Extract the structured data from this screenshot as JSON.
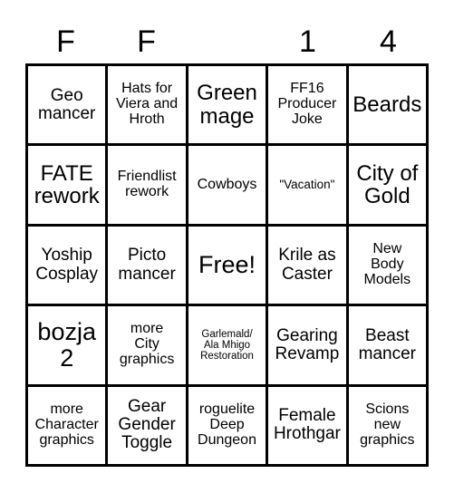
{
  "card": {
    "background_color": "#ffffff",
    "line_color": "#000000",
    "text_color": "#000000",
    "header": {
      "letters": [
        "F",
        "F",
        "",
        "1",
        "4"
      ]
    },
    "rows": [
      [
        {
          "text": "Geo\nmancer",
          "size": "l"
        },
        {
          "text": "Hats for\nViera and\nHroth",
          "size": "m"
        },
        {
          "text": "Green\nmage",
          "size": "xl"
        },
        {
          "text": "FF16\nProducer\nJoke",
          "size": "m"
        },
        {
          "text": "Beards",
          "size": "xl"
        }
      ],
      [
        {
          "text": "FATE\nrework",
          "size": "xl"
        },
        {
          "text": "Friendlist\nrework",
          "size": "m"
        },
        {
          "text": "Cowboys",
          "size": "m"
        },
        {
          "text": "\"Vacation\"",
          "size": "s"
        },
        {
          "text": "City of\nGold",
          "size": "xl"
        }
      ],
      [
        {
          "text": "Yoship\nCosplay",
          "size": "l"
        },
        {
          "text": "Picto\nmancer",
          "size": "l"
        },
        {
          "text": "Free!",
          "size": "xxl"
        },
        {
          "text": "Krile as\nCaster",
          "size": "l"
        },
        {
          "text": "New\nBody\nModels",
          "size": "m"
        }
      ],
      [
        {
          "text": "bozja\n2",
          "size": "xxl"
        },
        {
          "text": "more\nCity\ngraphics",
          "size": "m"
        },
        {
          "text": "Garlemald/\nAla Mhigo\nRestoration",
          "size": "xs"
        },
        {
          "text": "Gearing\nRevamp",
          "size": "l"
        },
        {
          "text": "Beast\nmancer",
          "size": "l"
        }
      ],
      [
        {
          "text": "more\nCharacter\ngraphics",
          "size": "m"
        },
        {
          "text": "Gear\nGender\nToggle",
          "size": "l"
        },
        {
          "text": "roguelite\nDeep\nDungeon",
          "size": "m"
        },
        {
          "text": "Female\nHrothgar",
          "size": "l"
        },
        {
          "text": "Scions\nnew\ngraphics",
          "size": "m"
        }
      ]
    ]
  }
}
